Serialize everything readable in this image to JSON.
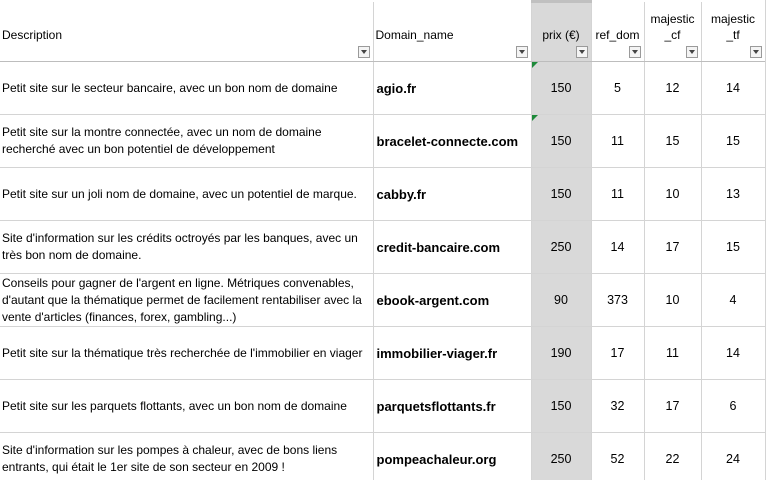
{
  "headers": {
    "description": "Description",
    "domain_name": "Domain_name",
    "prix": "prix (€)",
    "ref_dom": "ref_dom",
    "majestic_cf": "majestic\n_cf",
    "majestic_tf": "majestic\n_tf"
  },
  "rows": [
    {
      "description": "Petit site sur le secteur bancaire, avec un bon nom de domaine",
      "domain": "agio.fr",
      "prix": "150",
      "ref_dom": "5",
      "cf": "12",
      "tf": "14"
    },
    {
      "description": "Petit site sur la montre connectée, avec un nom de domaine recherché avec un bon potentiel de développement",
      "domain": "bracelet-connecte.com",
      "prix": "150",
      "ref_dom": "11",
      "cf": "15",
      "tf": "15"
    },
    {
      "description": "Petit site sur un joli nom de domaine, avec un potentiel de marque.",
      "domain": "cabby.fr",
      "prix": "150",
      "ref_dom": "11",
      "cf": "10",
      "tf": "13"
    },
    {
      "description": "Site d'information sur les crédits octroyés par les banques, avec un très bon nom de domaine.",
      "domain": "credit-bancaire.com",
      "prix": "250",
      "ref_dom": "14",
      "cf": "17",
      "tf": "15"
    },
    {
      "description": "Conseils pour gagner de l'argent en ligne. Métriques convenables, d'autant que la thématique permet de facilement rentabiliser avec la vente d'articles (finances, forex, gambling...)",
      "domain": "ebook-argent.com",
      "prix": "90",
      "ref_dom": "373",
      "cf": "10",
      "tf": "4"
    },
    {
      "description": "Petit site sur la  thématique très recherchée de l'immobilier en viager",
      "domain": "immobilier-viager.fr",
      "prix": "190",
      "ref_dom": "17",
      "cf": "11",
      "tf": "14"
    },
    {
      "description": "Petit site sur les parquets flottants, avec un bon nom de domaine",
      "domain": "parquetsflottants.fr",
      "prix": "150",
      "ref_dom": "32",
      "cf": "17",
      "tf": "6"
    },
    {
      "description": "Site d'information sur les pompes à chaleur, avec de bons liens entrants, qui était le 1er site de son secteur en 2009 !",
      "domain": "pompeachaleur.org",
      "prix": "250",
      "ref_dom": "52",
      "cf": "22",
      "tf": "24"
    }
  ],
  "colors": {
    "price_column_fill": "#d9d9d9",
    "comment_indicator": "#1e8a3a",
    "gridline": "#d4d4d4"
  }
}
